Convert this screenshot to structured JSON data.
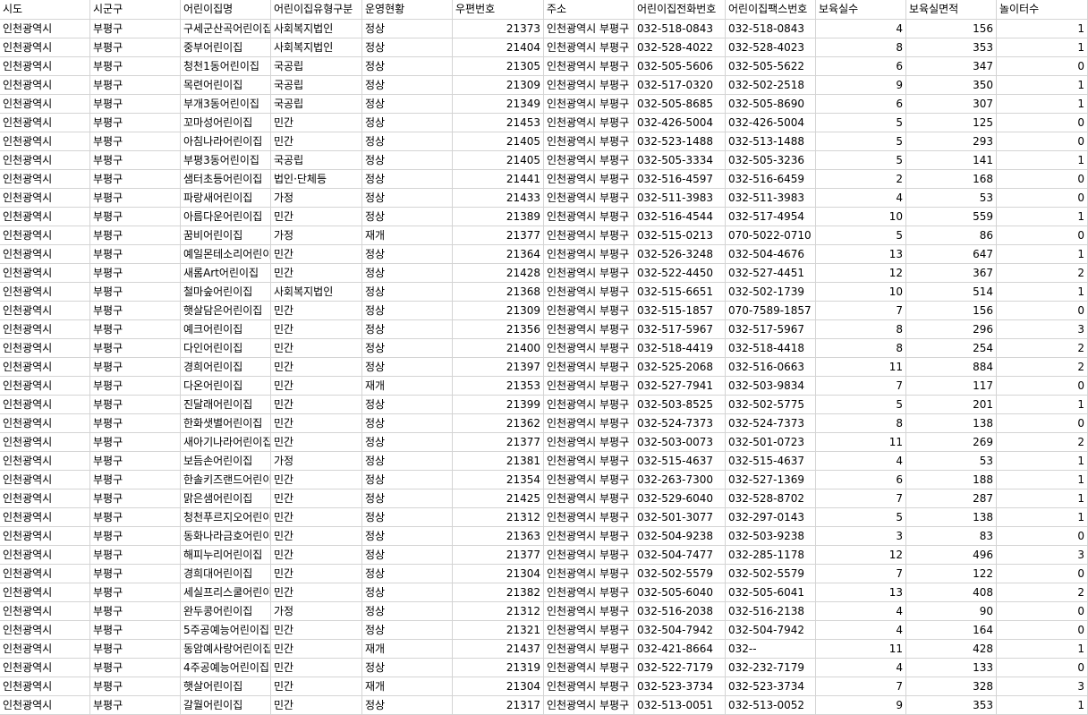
{
  "columns": [
    {
      "key": "sido",
      "label": "시도",
      "align": "left"
    },
    {
      "key": "sigungu",
      "label": "시군구",
      "align": "left"
    },
    {
      "key": "name",
      "label": "어린이집명",
      "align": "left"
    },
    {
      "key": "type",
      "label": "어린이집유형구분",
      "align": "left"
    },
    {
      "key": "status",
      "label": "운영현황",
      "align": "left"
    },
    {
      "key": "zip",
      "label": "우편번호",
      "align": "num"
    },
    {
      "key": "address",
      "label": "주소",
      "align": "left"
    },
    {
      "key": "phone",
      "label": "어린이집전화번호",
      "align": "left"
    },
    {
      "key": "fax",
      "label": "어린이집팩스번호",
      "align": "left"
    },
    {
      "key": "rooms",
      "label": "보육실수",
      "align": "num"
    },
    {
      "key": "area",
      "label": "보육실면적",
      "align": "num"
    },
    {
      "key": "playgrounds",
      "label": "놀이터수",
      "align": "num"
    }
  ],
  "rows": [
    [
      "인천광역시",
      "부평구",
      "구세군산곡어린이집",
      "사회복지법인",
      "정상",
      "21373",
      "인천광역시 부평구",
      "032-518-0843",
      "032-518-0843",
      "4",
      "156",
      "1"
    ],
    [
      "인천광역시",
      "부평구",
      "중부어린이집",
      "사회복지법인",
      "정상",
      "21404",
      "인천광역시 부평구",
      "032-528-4022",
      "032-528-4023",
      "8",
      "353",
      "1"
    ],
    [
      "인천광역시",
      "부평구",
      "청천1동어린이집",
      "국공립",
      "정상",
      "21305",
      "인천광역시 부평구",
      "032-505-5606",
      "032-505-5622",
      "6",
      "347",
      "0"
    ],
    [
      "인천광역시",
      "부평구",
      "목련어린이집",
      "국공립",
      "정상",
      "21309",
      "인천광역시 부평구",
      "032-517-0320",
      "032-502-2518",
      "9",
      "350",
      "1"
    ],
    [
      "인천광역시",
      "부평구",
      "부개3동어린이집",
      "국공립",
      "정상",
      "21349",
      "인천광역시 부평구",
      "032-505-8685",
      "032-505-8690",
      "6",
      "307",
      "1"
    ],
    [
      "인천광역시",
      "부평구",
      "꼬마성어린이집",
      "민간",
      "정상",
      "21453",
      "인천광역시 부평구",
      "032-426-5004",
      "032-426-5004",
      "5",
      "125",
      "0"
    ],
    [
      "인천광역시",
      "부평구",
      "아침나라어린이집",
      "민간",
      "정상",
      "21405",
      "인천광역시 부평구",
      "032-523-1488",
      "032-513-1488",
      "5",
      "293",
      "0"
    ],
    [
      "인천광역시",
      "부평구",
      "부평3동어린이집",
      "국공립",
      "정상",
      "21405",
      "인천광역시 부평구",
      "032-505-3334",
      "032-505-3236",
      "5",
      "141",
      "1"
    ],
    [
      "인천광역시",
      "부평구",
      "샘터초등어린이집",
      "법인·단체등",
      "정상",
      "21441",
      "인천광역시 부평구",
      "032-516-4597",
      "032-516-6459",
      "2",
      "168",
      "0"
    ],
    [
      "인천광역시",
      "부평구",
      "파랑새어린이집",
      "가정",
      "정상",
      "21433",
      "인천광역시 부평구",
      "032-511-3983",
      "032-511-3983",
      "4",
      "53",
      "0"
    ],
    [
      "인천광역시",
      "부평구",
      "아름다운어린이집",
      "민간",
      "정상",
      "21389",
      "인천광역시 부평구",
      "032-516-4544",
      "032-517-4954",
      "10",
      "559",
      "1"
    ],
    [
      "인천광역시",
      "부평구",
      "꿈비어린이집",
      "가정",
      "재개",
      "21377",
      "인천광역시 부평구",
      "032-515-0213",
      "070-5022-0710",
      "5",
      "86",
      "0"
    ],
    [
      "인천광역시",
      "부평구",
      "예일몬테소리어린이집",
      "민간",
      "정상",
      "21364",
      "인천광역시 부평구",
      "032-526-3248",
      "032-504-4676",
      "13",
      "647",
      "1"
    ],
    [
      "인천광역시",
      "부평구",
      "새롬Art어린이집",
      "민간",
      "정상",
      "21428",
      "인천광역시 부평구",
      "032-522-4450",
      "032-527-4451",
      "12",
      "367",
      "2"
    ],
    [
      "인천광역시",
      "부평구",
      "철마숲어린이집",
      "사회복지법인",
      "정상",
      "21368",
      "인천광역시 부평구",
      "032-515-6651",
      "032-502-1739",
      "10",
      "514",
      "1"
    ],
    [
      "인천광역시",
      "부평구",
      "햇살담은어린이집",
      "민간",
      "정상",
      "21309",
      "인천광역시 부평구",
      "032-515-1857",
      "070-7589-1857",
      "7",
      "156",
      "0"
    ],
    [
      "인천광역시",
      "부평구",
      "예크어린이집",
      "민간",
      "정상",
      "21356",
      "인천광역시 부평구",
      "032-517-5967",
      "032-517-5967",
      "8",
      "296",
      "3"
    ],
    [
      "인천광역시",
      "부평구",
      "다인어린이집",
      "민간",
      "정상",
      "21400",
      "인천광역시 부평구",
      "032-518-4419",
      "032-518-4418",
      "8",
      "254",
      "2"
    ],
    [
      "인천광역시",
      "부평구",
      "경희어린이집",
      "민간",
      "정상",
      "21397",
      "인천광역시 부평구",
      "032-525-2068",
      "032-516-0663",
      "11",
      "884",
      "2"
    ],
    [
      "인천광역시",
      "부평구",
      "다온어린이집",
      "민간",
      "재개",
      "21353",
      "인천광역시 부평구",
      "032-527-7941",
      "032-503-9834",
      "7",
      "117",
      "0"
    ],
    [
      "인천광역시",
      "부평구",
      "진달래어린이집",
      "민간",
      "정상",
      "21399",
      "인천광역시 부평구",
      "032-503-8525",
      "032-502-5775",
      "5",
      "201",
      "1"
    ],
    [
      "인천광역시",
      "부평구",
      "한화샛별어린이집",
      "민간",
      "정상",
      "21362",
      "인천광역시 부평구",
      "032-524-7373",
      "032-524-7373",
      "8",
      "138",
      "0"
    ],
    [
      "인천광역시",
      "부평구",
      "새아기나라어린이집",
      "민간",
      "정상",
      "21377",
      "인천광역시 부평구",
      "032-503-0073",
      "032-501-0723",
      "11",
      "269",
      "2"
    ],
    [
      "인천광역시",
      "부평구",
      "보듬손어린이집",
      "가정",
      "정상",
      "21381",
      "인천광역시 부평구",
      "032-515-4637",
      "032-515-4637",
      "4",
      "53",
      "1"
    ],
    [
      "인천광역시",
      "부평구",
      "한솔키즈랜드어린이집",
      "민간",
      "정상",
      "21354",
      "인천광역시 부평구",
      "032-263-7300",
      "032-527-1369",
      "6",
      "188",
      "1"
    ],
    [
      "인천광역시",
      "부평구",
      "맑은샘어린이집",
      "민간",
      "정상",
      "21425",
      "인천광역시 부평구",
      "032-529-6040",
      "032-528-8702",
      "7",
      "287",
      "1"
    ],
    [
      "인천광역시",
      "부평구",
      "청천푸르지오어린이집",
      "민간",
      "정상",
      "21312",
      "인천광역시 부평구",
      "032-501-3077",
      "032-297-0143",
      "5",
      "138",
      "1"
    ],
    [
      "인천광역시",
      "부평구",
      "동화나라금호어린이집",
      "민간",
      "정상",
      "21363",
      "인천광역시 부평구",
      "032-504-9238",
      "032-503-9238",
      "3",
      "83",
      "0"
    ],
    [
      "인천광역시",
      "부평구",
      "해피누리어린이집",
      "민간",
      "정상",
      "21377",
      "인천광역시 부평구",
      "032-504-7477",
      "032-285-1178",
      "12",
      "496",
      "3"
    ],
    [
      "인천광역시",
      "부평구",
      "경희대어린이집",
      "민간",
      "정상",
      "21304",
      "인천광역시 부평구",
      "032-502-5579",
      "032-502-5579",
      "7",
      "122",
      "0"
    ],
    [
      "인천광역시",
      "부평구",
      "세실프리스쿨어린이집",
      "민간",
      "정상",
      "21382",
      "인천광역시 부평구",
      "032-505-6040",
      "032-505-6041",
      "13",
      "408",
      "2"
    ],
    [
      "인천광역시",
      "부평구",
      "완두콩어린이집",
      "가정",
      "정상",
      "21312",
      "인천광역시 부평구",
      "032-516-2038",
      "032-516-2138",
      "4",
      "90",
      "0"
    ],
    [
      "인천광역시",
      "부평구",
      "5주공예능어린이집",
      "민간",
      "정상",
      "21321",
      "인천광역시 부평구",
      "032-504-7942",
      "032-504-7942",
      "4",
      "164",
      "0"
    ],
    [
      "인천광역시",
      "부평구",
      "동암예사랑어린이집",
      "민간",
      "재개",
      "21437",
      "인천광역시 부평구",
      "032-421-8664",
      "032--",
      "11",
      "428",
      "1"
    ],
    [
      "인천광역시",
      "부평구",
      "4주공예능어린이집",
      "민간",
      "정상",
      "21319",
      "인천광역시 부평구",
      "032-522-7179",
      "032-232-7179",
      "4",
      "133",
      "0"
    ],
    [
      "인천광역시",
      "부평구",
      "햇살어린이집",
      "민간",
      "재개",
      "21304",
      "인천광역시 부평구",
      "032-523-3734",
      "032-523-3734",
      "7",
      "328",
      "3"
    ],
    [
      "인천광역시",
      "부평구",
      "갈월어린이집",
      "민간",
      "정상",
      "21317",
      "인천광역시 부평구",
      "032-513-0051",
      "032-513-0052",
      "9",
      "353",
      "1"
    ]
  ]
}
